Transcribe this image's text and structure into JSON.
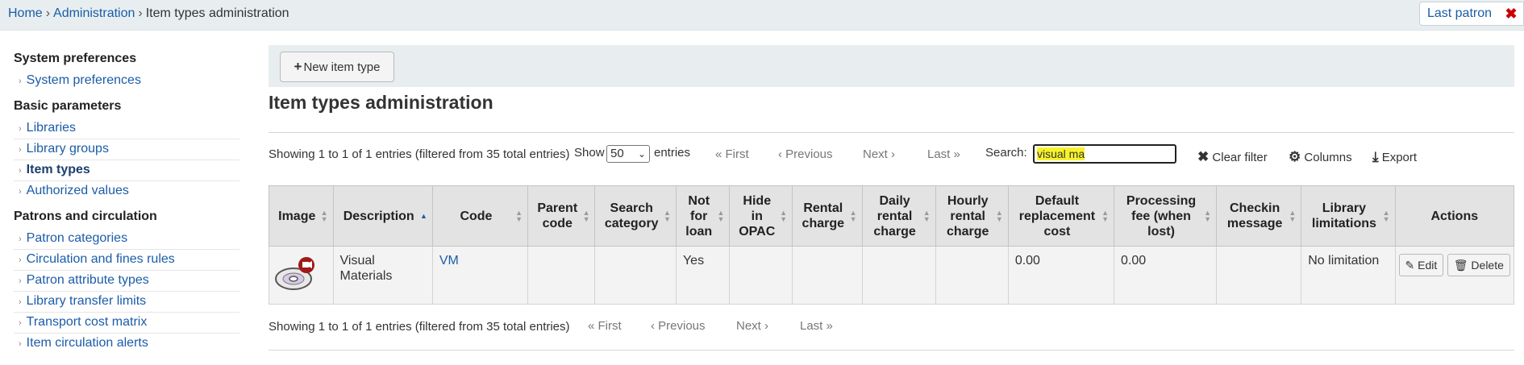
{
  "breadcrumb": {
    "home": "Home",
    "admin": "Administration",
    "current": "Item types administration",
    "sep": "›"
  },
  "last_patron": {
    "label": "Last patron",
    "close": "✖"
  },
  "sidebar": {
    "sections": [
      {
        "heading": "System preferences",
        "items": [
          "System preferences"
        ]
      },
      {
        "heading": "Basic parameters",
        "items": [
          "Libraries",
          "Library groups",
          "Item types",
          "Authorized values"
        ]
      },
      {
        "heading": "Patrons and circulation",
        "items": [
          "Patron categories",
          "Circulation and fines rules",
          "Patron attribute types",
          "Library transfer limits",
          "Transport cost matrix",
          "Item circulation alerts"
        ]
      }
    ],
    "arrow": "›"
  },
  "toolbar": {
    "new_label": "New item type"
  },
  "page_title": "Item types administration",
  "controls": {
    "info_top": "Showing 1 to 1 of 1 entries (filtered from 35 total entries)",
    "info_bottom": "Showing 1 to 1 of 1 entries (filtered from 35 total entries)",
    "show": "Show",
    "show_value": "50",
    "entries": "entries",
    "pager": {
      "first": "« First",
      "previous": "‹ Previous",
      "next": "Next ›",
      "last": "Last »"
    },
    "search_label": "Search:",
    "search_value_highlight": "visual ma",
    "clear_filter": "Clear filter",
    "columns": "Columns",
    "export": "Export"
  },
  "table": {
    "headers": [
      "Image",
      "Description",
      "Code",
      "Parent code",
      "Search category",
      "Not for loan",
      "Hide in OPAC",
      "Rental charge",
      "Daily rental charge",
      "Hourly rental charge",
      "Default replacement cost",
      "Processing fee (when lost)",
      "Checkin message",
      "Library limitations",
      "Actions"
    ],
    "rows": [
      {
        "description": "Visual Materials",
        "code": "VM",
        "parent_code": "",
        "search_category": "",
        "not_for_loan": "Yes",
        "hide_in_opac": "",
        "rental_charge": "",
        "daily_rental_charge": "",
        "hourly_rental_charge": "",
        "default_replacement_cost": "0.00",
        "processing_fee": "0.00",
        "checkin_message": "",
        "library_limitations": "No limitation",
        "edit": "Edit",
        "delete": "Delete"
      }
    ]
  },
  "colors": {
    "link": "#1b5ca8",
    "highlight": "#f7f22a",
    "bar": "#e8eef0",
    "close": "#cc0000"
  }
}
